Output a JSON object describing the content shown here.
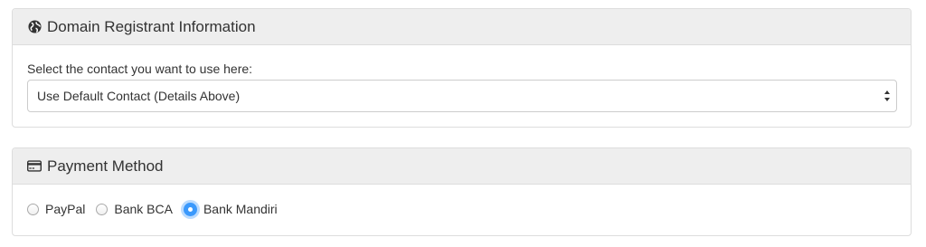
{
  "registrant": {
    "title": "Domain Registrant Information",
    "icon": "globe-icon",
    "select_label": "Select the contact you want to use here:",
    "select_value": "Use Default Contact (Details Above)"
  },
  "payment": {
    "title": "Payment Method",
    "icon": "credit-card-icon",
    "options": [
      {
        "label": "PayPal",
        "selected": false
      },
      {
        "label": "Bank BCA",
        "selected": false
      },
      {
        "label": "Bank Mandiri",
        "selected": true
      }
    ]
  },
  "colors": {
    "accent": "#3b99fc",
    "heading_bg": "#eeeeee",
    "border": "#dddddd"
  }
}
